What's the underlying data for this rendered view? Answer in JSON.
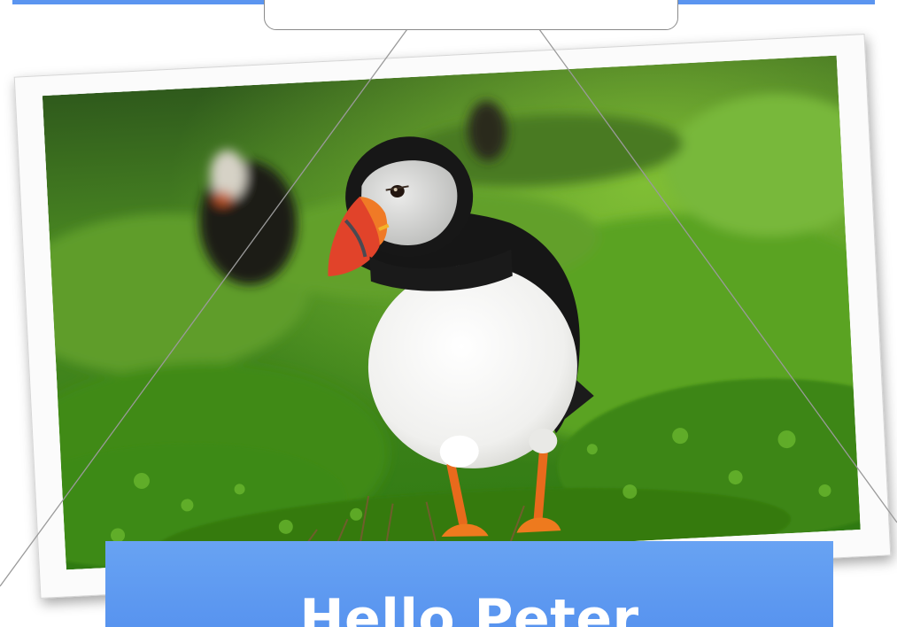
{
  "greeting": {
    "text": "Hello Peter"
  },
  "photo": {
    "subject": "puffin-on-grass"
  },
  "colors": {
    "banner": "#5b95f0",
    "string": "#9a9a9a",
    "frame": "#fbfbfb"
  }
}
